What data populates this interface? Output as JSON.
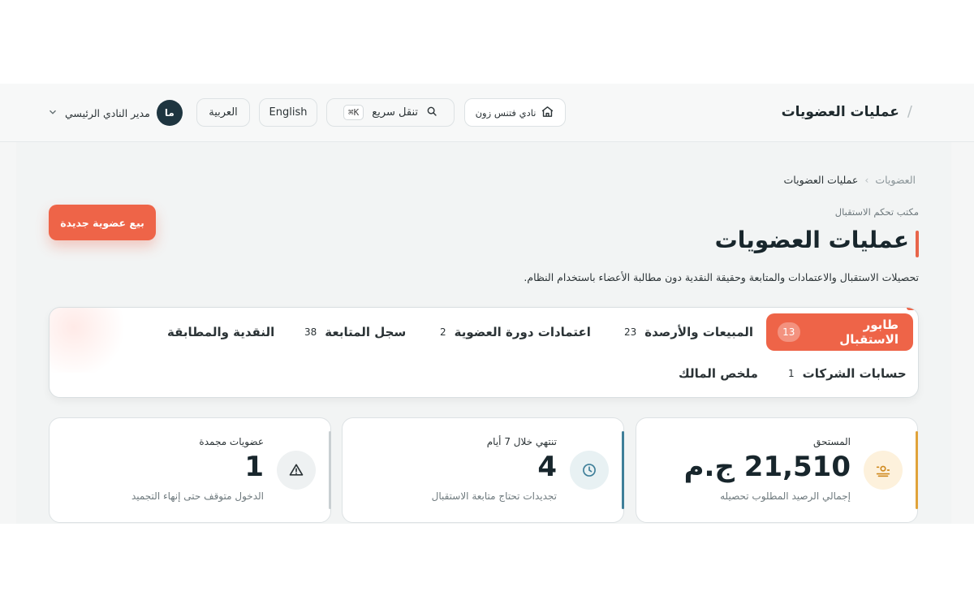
{
  "header": {
    "slash": "/",
    "title": "عمليات العضويات",
    "club_label": "نادي فتنس زون",
    "search_label": "تنقل سريع",
    "search_shortcut": "K⌘",
    "lang_en": "English",
    "lang_ar": "العربية",
    "user_initials": "ما",
    "user_name": "مدير النادي الرئيسي"
  },
  "breadcrumb": {
    "root": "العضويات",
    "sep": "›",
    "current": "عمليات العضويات"
  },
  "page": {
    "kicker": "مكتب تحكم الاستقبال",
    "title": "عمليات العضويات",
    "subtitle": "تحصيلات الاستقبال والاعتمادات والمتابعة وحقيقة النقدية دون مطالبة الأعضاء باستخدام النظام.",
    "cta_label": "بيع عضوية جديدة",
    "accent_color": "#ee6448"
  },
  "tabs": [
    {
      "label": "طابور الاستقبال",
      "count": "13",
      "active": true
    },
    {
      "label": "المبيعات والأرصدة",
      "count": "23"
    },
    {
      "label": "اعتمادات دورة العضوية",
      "count": "2"
    },
    {
      "label": "سجل المتابعة",
      "count": "38"
    },
    {
      "label": "النقدية والمطابقة",
      "count": ""
    },
    {
      "label": "حسابات الشركات",
      "count": "1"
    },
    {
      "label": "ملخص المالك",
      "count": ""
    }
  ],
  "cards": [
    {
      "label": "المستحق",
      "value": "21,510 ج.م",
      "desc": "إجمالي الرصيد المطلوب تحصيله",
      "icon": "cash-icon",
      "accent": "#e0a33a"
    },
    {
      "label": "تنتهي خلال 7 أيام",
      "value": "4",
      "desc": "تجديدات تحتاج متابعة الاستقبال",
      "icon": "clock-icon",
      "accent": "#3f7f99"
    },
    {
      "label": "عضويات مجمدة",
      "value": "1",
      "desc": "الدخول متوقف حتى إنهاء التجميد",
      "icon": "warning-icon",
      "accent": "#c9cfd2"
    }
  ]
}
